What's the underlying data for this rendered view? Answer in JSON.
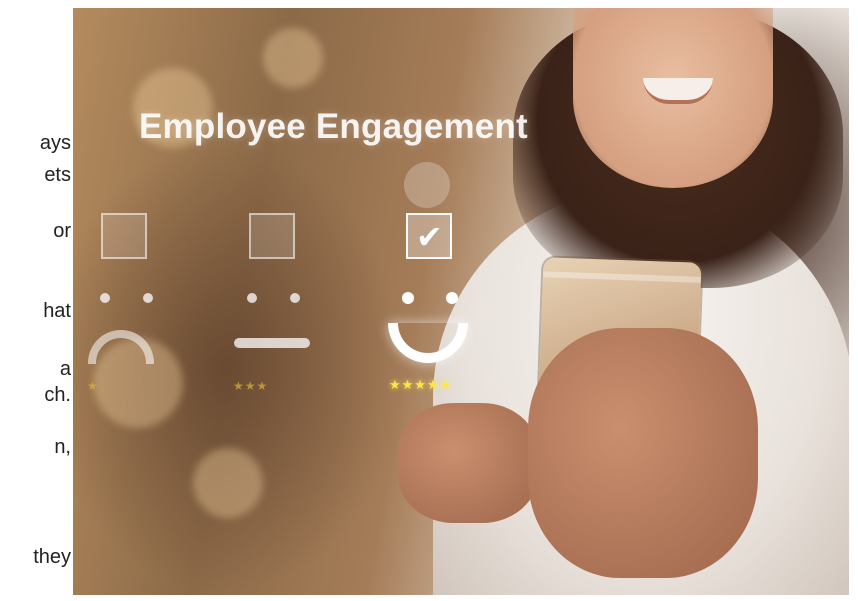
{
  "headline": "Employee Engagement",
  "rating_scale": [
    {
      "level": "unhappy",
      "checked": false,
      "stars": 1
    },
    {
      "level": "neutral",
      "checked": false,
      "stars": 3
    },
    {
      "level": "happy",
      "checked": true,
      "stars": 5
    }
  ],
  "check_glyph": "✔",
  "stars_1": "★",
  "stars_3": "★★★",
  "stars_5": "★★★★★",
  "side_text_fragments": [
    "ays",
    "ets",
    "or",
    "hat",
    "a",
    "ch.",
    "n,",
    "they"
  ],
  "colors": {
    "star_gold": "#f2d34a",
    "overlay_white": "#ffffff"
  }
}
